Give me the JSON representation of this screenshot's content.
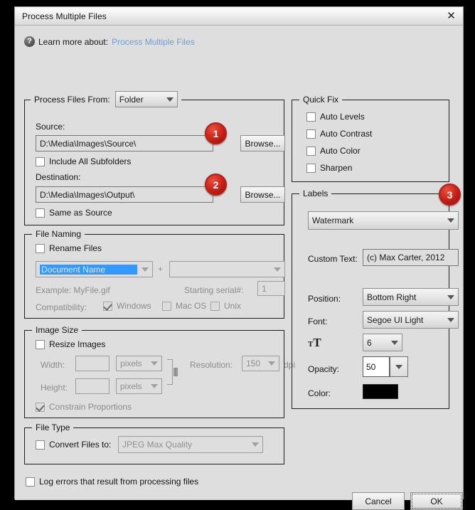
{
  "window": {
    "title": "Process Multiple Files",
    "close_icon": "close-icon"
  },
  "help": {
    "icon": "question-mark-icon",
    "label": "Learn more about:",
    "link": "Process Multiple Files"
  },
  "process_files_from": {
    "label": "Process Files From:",
    "value": "Folder"
  },
  "source": {
    "label": "Source:",
    "path": "D:\\Media\\Images\\Source\\",
    "browse_label": "Browse...",
    "include_subfolders_label": "Include All Subfolders",
    "include_subfolders_checked": false
  },
  "destination": {
    "label": "Destination:",
    "path": "D:\\Media\\Images\\Output\\",
    "browse_label": "Browse...",
    "same_as_source_label": "Same as Source",
    "same_as_source_checked": false
  },
  "file_naming": {
    "title": "File Naming",
    "rename_label": "Rename Files",
    "rename_checked": false,
    "name_part1": "Document Name",
    "plus": "+",
    "name_part2": "",
    "example_label": "Example: MyFile.gif",
    "serial_label": "Starting serial#:",
    "serial_value": "1",
    "compatibility_label": "Compatibility:",
    "compat": [
      {
        "label": "Windows",
        "checked": true
      },
      {
        "label": "Mac OS",
        "checked": false
      },
      {
        "label": "Unix",
        "checked": false
      }
    ]
  },
  "image_size": {
    "title": "Image Size",
    "resize_label": "Resize Images",
    "resize_checked": false,
    "width_label": "Width:",
    "width_value": "",
    "width_unit": "pixels",
    "height_label": "Height:",
    "height_value": "",
    "height_unit": "pixels",
    "resolution_label": "Resolution:",
    "resolution_value": "150",
    "resolution_unit": "dpi",
    "constrain_label": "Constrain Proportions",
    "constrain_checked": true
  },
  "file_type": {
    "title": "File Type",
    "convert_label": "Convert Files to:",
    "convert_checked": false,
    "format_value": "JPEG Max Quality"
  },
  "log_errors": {
    "label": "Log errors that result from processing files",
    "checked": false
  },
  "quick_fix": {
    "title": "Quick Fix",
    "items": [
      {
        "label": "Auto Levels",
        "checked": false
      },
      {
        "label": "Auto Contrast",
        "checked": false
      },
      {
        "label": "Auto Color",
        "checked": false
      },
      {
        "label": "Sharpen",
        "checked": false
      }
    ]
  },
  "labels_panel": {
    "title": "Labels",
    "type_value": "Watermark",
    "custom_text_label": "Custom Text:",
    "custom_text_value": "(c) Max Carter, 2012",
    "position_label": "Position:",
    "position_value": "Bottom Right",
    "font_label": "Font:",
    "font_value": "Segoe UI Light",
    "size_icon": "font-size-icon",
    "size_value": "6",
    "opacity_label": "Opacity:",
    "opacity_value": "50",
    "color_label": "Color:",
    "color_value": "#000000"
  },
  "footer": {
    "cancel_label": "Cancel",
    "ok_label": "OK"
  },
  "callouts": [
    {
      "number": "1"
    },
    {
      "number": "2"
    },
    {
      "number": "3"
    }
  ]
}
